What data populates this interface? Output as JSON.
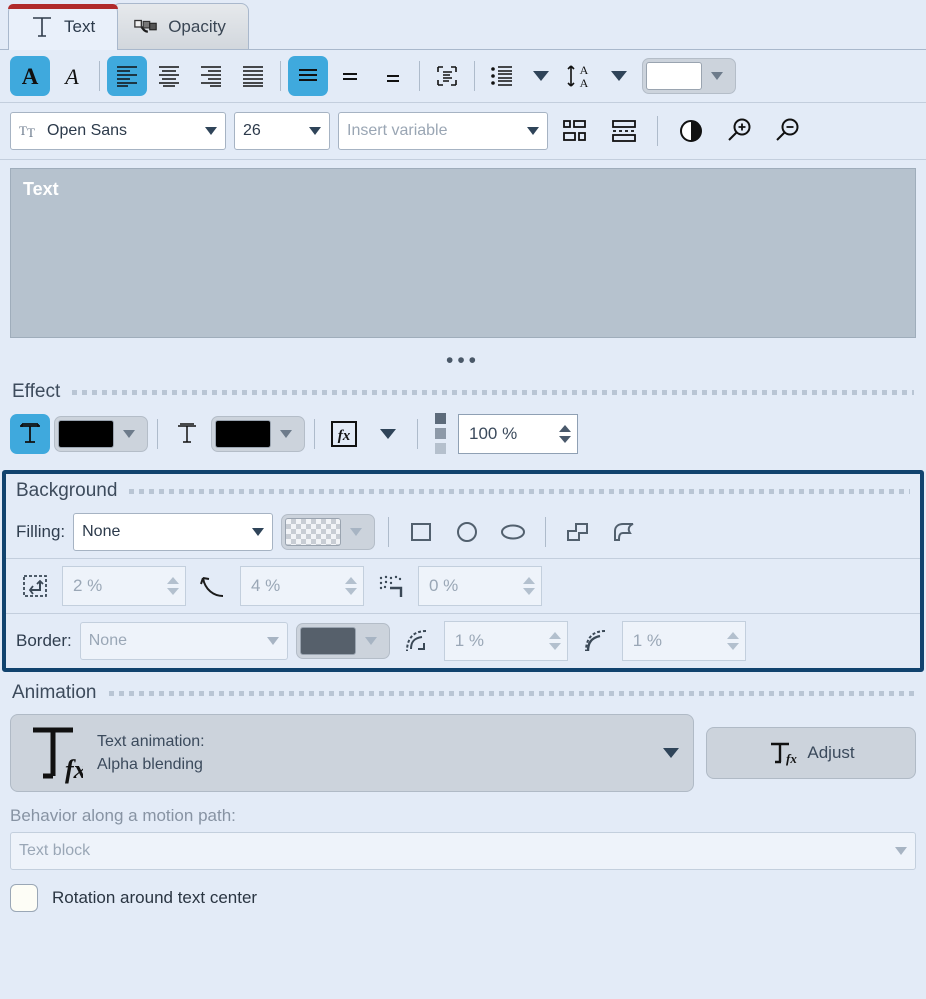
{
  "tabs": [
    {
      "label": "Text",
      "icon": "text-t-icon",
      "active": true
    },
    {
      "label": "Opacity",
      "icon": "opacity-curve-icon",
      "active": false
    }
  ],
  "toolbar_format": {
    "bold": {
      "label": "A",
      "name": "bold-button",
      "selected": true
    },
    "italic": {
      "label": "A",
      "name": "italic-button",
      "selected": false
    },
    "align_left": {
      "name": "align-left-button",
      "selected": true
    },
    "align_center": {
      "name": "align-center-button",
      "selected": false
    },
    "align_right": {
      "name": "align-right-button",
      "selected": false
    },
    "align_justify": {
      "name": "align-justify-button",
      "selected": false
    },
    "vert_top": {
      "name": "valign-top-button",
      "selected": true
    },
    "vert_middle": {
      "name": "valign-middle-button",
      "selected": false
    },
    "vert_bottom": {
      "name": "valign-bottom-button",
      "selected": false
    },
    "text_frame": {
      "name": "text-frame-button"
    },
    "bullet_list": {
      "name": "bullet-list-button"
    },
    "line_spacing": {
      "name": "line-spacing-button"
    },
    "text_color": {
      "name": "text-color-swatch",
      "color": "#ffffff"
    }
  },
  "toolbar_font": {
    "font_family": {
      "value": "Open Sans",
      "name": "font-family-combo"
    },
    "font_size": {
      "value": "26",
      "name": "font-size-combo"
    },
    "insert_variable": {
      "placeholder": "Insert variable",
      "value": "",
      "name": "insert-variable-combo"
    },
    "align_objects": {
      "name": "align-objects-button"
    },
    "distribute": {
      "name": "distribute-button"
    },
    "contrast": {
      "name": "contrast-button"
    },
    "zoom_in": {
      "name": "zoom-in-button"
    },
    "zoom_out": {
      "name": "zoom-out-button"
    }
  },
  "text_editor": {
    "value": "Text",
    "handle": "•••"
  },
  "effect": {
    "title": "Effect",
    "shadow_toggle": {
      "name": "shadow-toggle",
      "selected": true
    },
    "shadow_color": "#000000",
    "outline_toggle": {
      "name": "outline-toggle",
      "selected": false
    },
    "outline_color": "#000000",
    "fx_button": {
      "name": "effect-fx-button"
    },
    "opacity": {
      "value": "100 %",
      "name": "effect-opacity-spinner"
    }
  },
  "background": {
    "title": "Background",
    "filling_label": "Filling:",
    "filling_value": "None",
    "fill_swatch": "transparent-checkerboard",
    "shapes": [
      {
        "name": "shape-rectangle-button"
      },
      {
        "name": "shape-circle-button"
      },
      {
        "name": "shape-ellipse-button"
      },
      {
        "name": "shape-polygon-button"
      },
      {
        "name": "shape-freeform-button"
      }
    ],
    "padding": {
      "value": "2 %",
      "name": "padding-spinner",
      "enabled": false
    },
    "corner": {
      "value": "4 %",
      "name": "corner-spinner",
      "enabled": false
    },
    "offset": {
      "value": "0 %",
      "name": "offset-spinner",
      "enabled": false
    },
    "border_label": "Border:",
    "border_value": "None",
    "border_color": "#56606b",
    "border_width": {
      "value": "1 %",
      "name": "border-width-spinner",
      "enabled": false
    },
    "border_radius": {
      "value": "1 %",
      "name": "border-radius-spinner",
      "enabled": false
    }
  },
  "animation": {
    "title": "Animation",
    "label": "Text animation:",
    "value": "Alpha blending",
    "adjust_label": "Adjust",
    "behavior_label": "Behavior along a motion path:",
    "behavior_value": "Text block",
    "rotation_label": "Rotation around text center",
    "rotation_checked": false
  },
  "colors": {
    "accent": "#3fa9dd",
    "highlight_border": "#11436e",
    "tab_accent": "#b02a2a",
    "page_bg": "#e3ebf7"
  }
}
